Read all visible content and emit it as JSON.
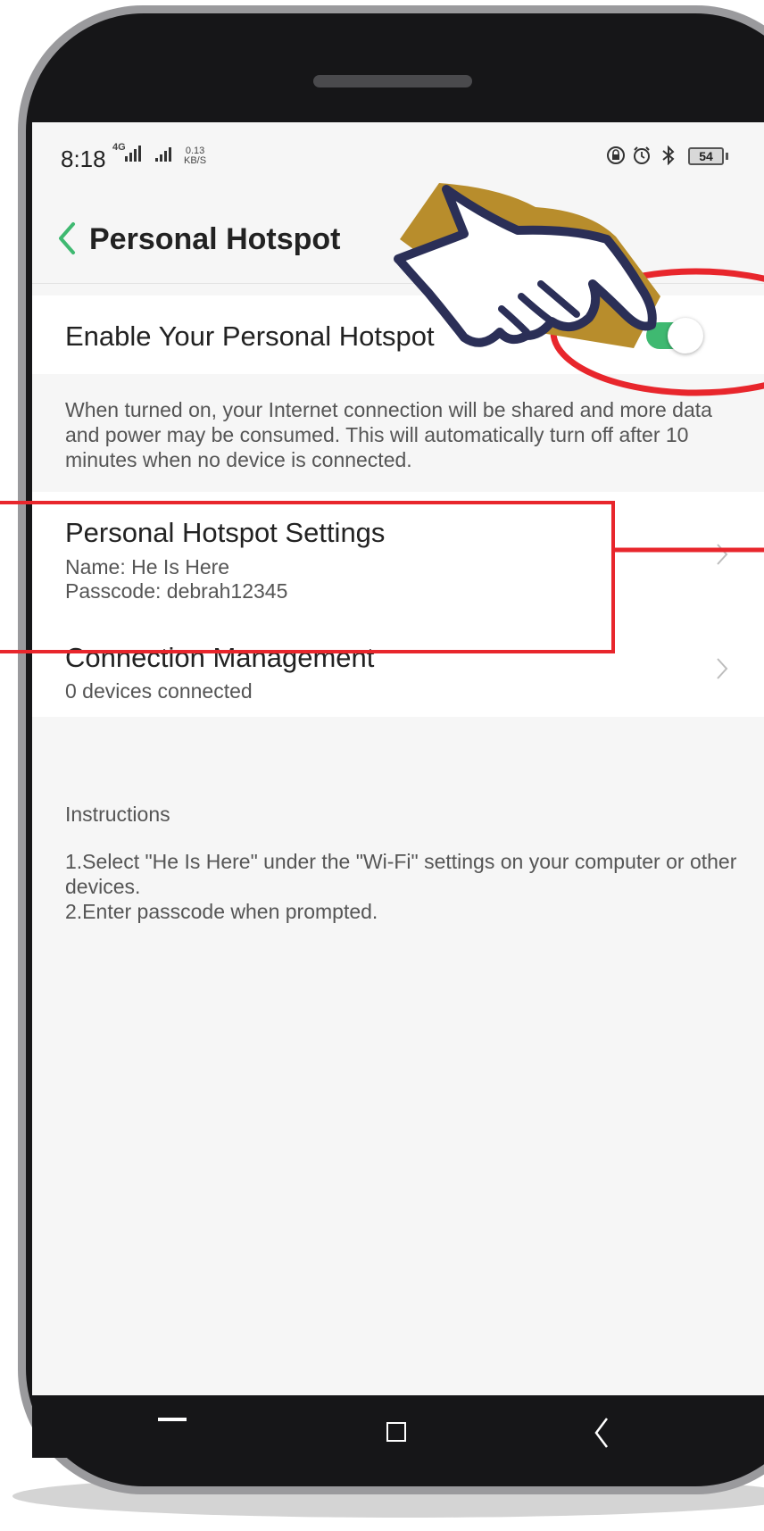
{
  "status_bar": {
    "time": "8:18",
    "network_type": "4G",
    "speed_value": "0.13",
    "speed_unit": "KB/S",
    "battery": "54",
    "icons": [
      "lock-rotation-icon",
      "alarm-icon",
      "bluetooth-icon",
      "battery-icon"
    ]
  },
  "header": {
    "back_icon": "chevron-left-icon",
    "title": "Personal Hotspot"
  },
  "hotspot_toggle": {
    "label": "Enable Your Personal Hotspot",
    "enabled": true,
    "color_on": "#3fb971"
  },
  "description": "When turned on, your Internet connection will be shared and more data and power may be consumed. This will automatically turn off after 10 minutes when no device is connected.",
  "settings_row": {
    "title": "Personal Hotspot Settings",
    "name_line": "Name: He Is Here",
    "passcode_line": "Passcode: debrah12345"
  },
  "connection_row": {
    "title": "Connection Management",
    "subtitle": "0 devices connected"
  },
  "instructions": {
    "heading": "Instructions",
    "step1": "1.Select \"He Is Here\" under the \"Wi-Fi\" settings on your computer or other devices.",
    "step2": "2.Enter passcode when prompted."
  },
  "nav_bar": {
    "icons": [
      "recent-apps-icon",
      "home-icon",
      "back-icon"
    ]
  },
  "annotations": {
    "highlight_color": "#e8262c",
    "hand_outline_color": "#2b2f57",
    "hand_shadow_color": "#b88d2c"
  }
}
